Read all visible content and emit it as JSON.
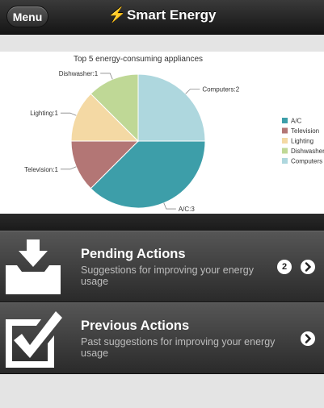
{
  "header": {
    "menu_label": "Menu",
    "bolt_glyph": "⚡",
    "title": "Smart Energy"
  },
  "chart_data": {
    "type": "pie",
    "title": "Top 5 energy-consuming appliances",
    "slices": [
      {
        "label": "A/C",
        "value": 3,
        "color": "#3d9ea9"
      },
      {
        "label": "Television",
        "value": 1,
        "color": "#b37675"
      },
      {
        "label": "Lighting",
        "value": 1,
        "color": "#f4d9a4"
      },
      {
        "label": "Dishwasher",
        "value": 1,
        "color": "#bfd896"
      },
      {
        "label": "Computers",
        "value": 2,
        "color": "#aed7de"
      }
    ],
    "callouts": [
      "A/C:3",
      "Television:1",
      "Lighting:1",
      "Dishwasher:1",
      "Computers:2"
    ],
    "legend": [
      "A/C",
      "Television",
      "Lighting",
      "Dishwasher",
      "Computers"
    ],
    "legend_position": "right"
  },
  "actions": {
    "pending": {
      "title": "Pending Actions",
      "description": "Suggestions for improving your energy usage",
      "count": "2",
      "icon": "inbox-download-icon"
    },
    "previous": {
      "title": "Previous Actions",
      "description": "Past suggestions for improving your energy usage",
      "icon": "checkbox-checked-icon"
    }
  }
}
